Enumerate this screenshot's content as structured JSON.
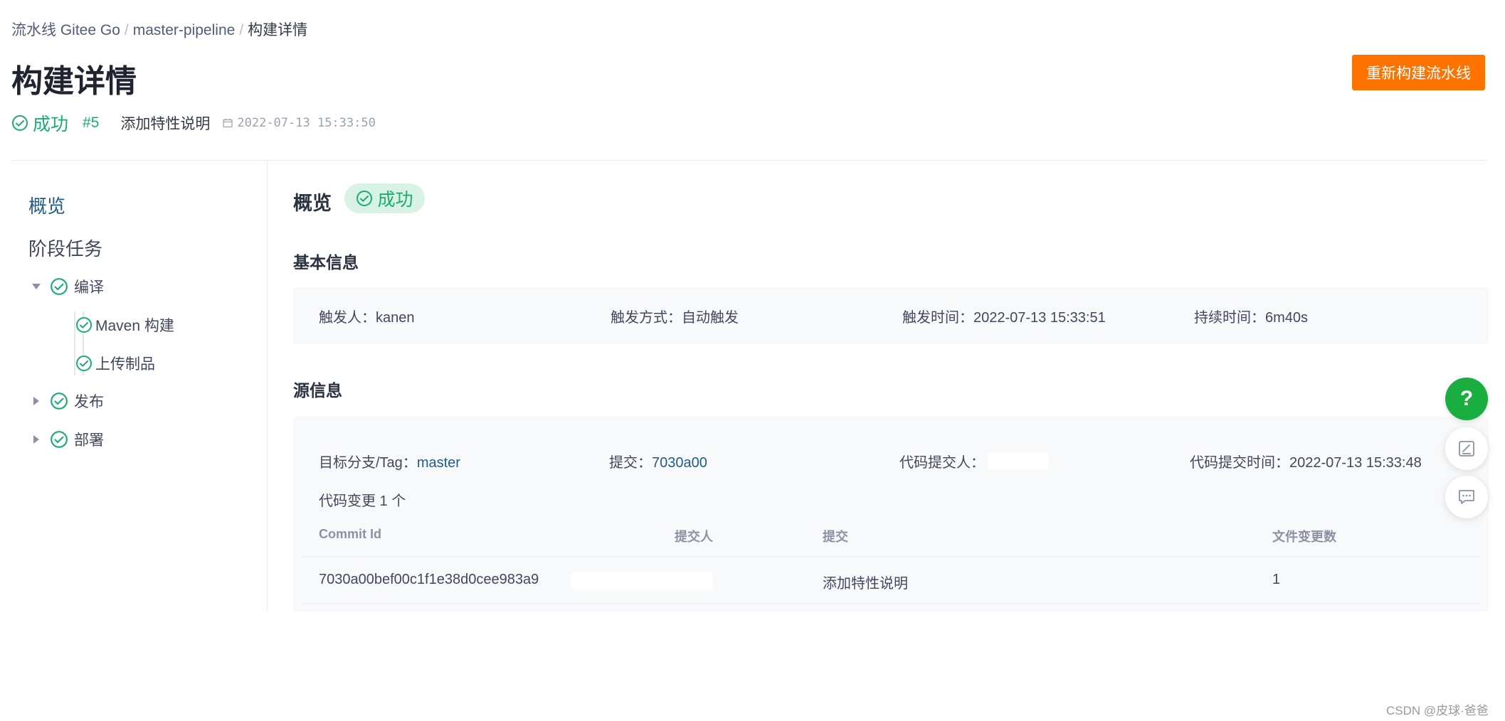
{
  "breadcrumb": {
    "items": [
      "流水线 Gitee Go",
      "master-pipeline",
      "构建详情"
    ],
    "separator": "/"
  },
  "page": {
    "title": "构建详情",
    "rebuild_label": "重新构建流水线"
  },
  "build": {
    "status": "成功",
    "number": "#5",
    "commit_message": "添加特性说明",
    "time": "2022-07-13 15:33:50"
  },
  "sidebar": {
    "overview_label": "概览",
    "stages_label": "阶段任务",
    "stages": [
      {
        "label": "编译",
        "expanded": true,
        "jobs": [
          "Maven 构建",
          "上传制品"
        ]
      },
      {
        "label": "发布",
        "expanded": false
      },
      {
        "label": "部署",
        "expanded": false
      }
    ]
  },
  "overview": {
    "title": "概览",
    "status": "成功",
    "basic_title": "基本信息",
    "basic": {
      "trigger_user_label": "触发人：",
      "trigger_user": "kanen",
      "trigger_mode_label": "触发方式：",
      "trigger_mode": "自动触发",
      "trigger_time_label": "触发时间：",
      "trigger_time": "2022-07-13 15:33:51",
      "duration_label": "持续时间：",
      "duration": "6m40s"
    },
    "source_title": "源信息",
    "source": {
      "branch_label": "目标分支/Tag：",
      "branch": "master",
      "commit_label": "提交：",
      "commit": "7030a00",
      "committer_label": "代码提交人：",
      "committer": "",
      "commit_time_label": "代码提交时间：",
      "commit_time": "2022-07-13 15:33:48",
      "changes_label": "代码变更 1 个"
    },
    "table": {
      "headers": [
        "Commit Id",
        "提交人",
        "提交",
        "文件变更数"
      ],
      "rows": [
        {
          "commit_id": "7030a00bef00c1f1e38d0cee983a9",
          "committer": "",
          "message": "添加特性说明",
          "files": "1"
        }
      ]
    }
  },
  "colors": {
    "accent_orange": "#fe7300",
    "success_green": "#1aad6e",
    "link_blue": "#1f5c8b",
    "help_green": "#1aad3f"
  },
  "watermark": "CSDN @皮球·爸爸"
}
